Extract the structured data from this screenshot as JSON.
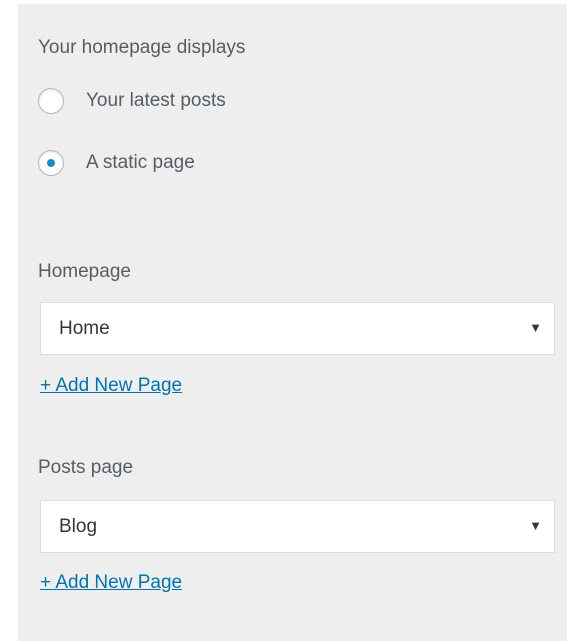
{
  "homepage_settings": {
    "section_title": "Your homepage displays",
    "options": [
      {
        "label": "Your latest posts",
        "selected": false
      },
      {
        "label": "A static page",
        "selected": true
      }
    ],
    "homepage": {
      "label": "Homepage",
      "selected_value": "Home",
      "add_link": "+ Add New Page"
    },
    "posts_page": {
      "label": "Posts page",
      "selected_value": "Blog",
      "add_link": "+ Add New Page"
    },
    "dropdown_arrow": "▼"
  },
  "colors": {
    "panel_background": "#eeeeee",
    "text": "#555d66",
    "link": "#0073aa",
    "radio_selected": "#1e8cbe"
  }
}
